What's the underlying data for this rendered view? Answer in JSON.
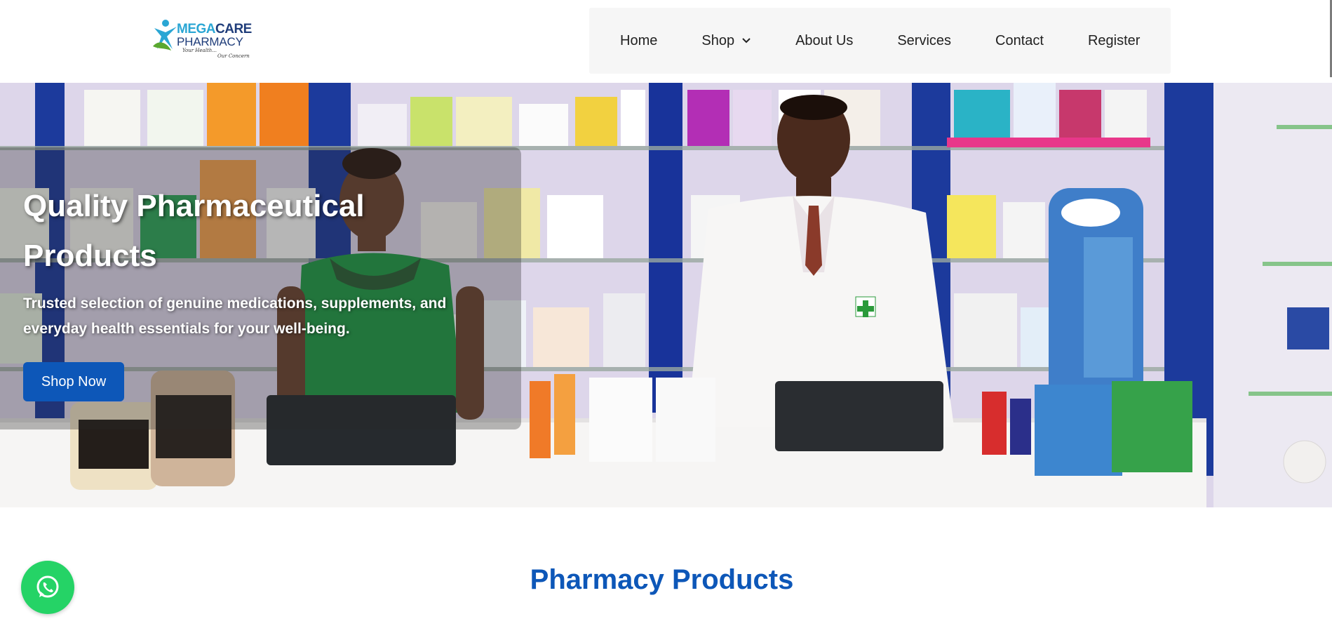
{
  "brand": {
    "name_part1": "MEGA",
    "name_part2": "CARE",
    "name_line2": "PHARMACY",
    "tagline_1": "Your Health...",
    "tagline_2": "Our Concern",
    "colors": {
      "light_blue": "#2aa6d4",
      "navy": "#1f3d7a",
      "green": "#5aa830"
    }
  },
  "nav": {
    "items": [
      {
        "label": "Home"
      },
      {
        "label": "Shop",
        "has_dropdown": true
      },
      {
        "label": "About Us"
      },
      {
        "label": "Services"
      },
      {
        "label": "Contact"
      },
      {
        "label": "Register"
      }
    ]
  },
  "hero": {
    "title": "Quality Pharmaceutical Products",
    "subtitle": "Trusted selection of genuine medications, supplements, and everyday health essentials for your well-being.",
    "cta_label": "Shop Now",
    "image_description_icon": "pharmacy-staff-photo"
  },
  "section": {
    "title": "Pharmacy Products"
  },
  "floating": {
    "whatsapp_icon": "whatsapp-icon"
  },
  "theme": {
    "primary": "#0d57b8",
    "whatsapp_green": "#25d366",
    "nav_bg": "#f6f6f6"
  }
}
